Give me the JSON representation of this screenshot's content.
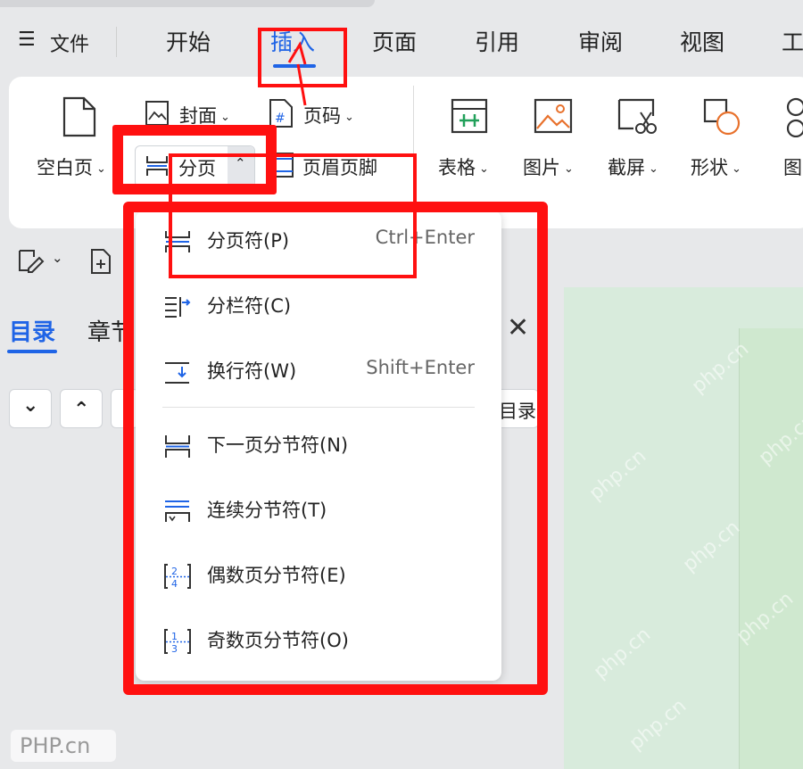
{
  "menubar": {
    "hamburger": "☰",
    "file_label": "文件",
    "items": [
      "开始",
      "插入",
      "页面",
      "引用",
      "审阅",
      "视图",
      "工"
    ],
    "active_index": 1
  },
  "ribbon": {
    "blank_page": "空白页",
    "cover": "封面",
    "page_break": "分页",
    "page_number": "页码",
    "header_footer": "页眉页脚",
    "table": "表格",
    "picture": "图片",
    "screenshot": "截屏",
    "shape": "形状",
    "chart_partial": "图"
  },
  "panel": {
    "tab_toc": "目录",
    "tab_chapter": "章节",
    "toc_button_partial": "目录"
  },
  "dropdown": {
    "items": [
      {
        "label": "分页符(P)",
        "shortcut": "Ctrl+Enter"
      },
      {
        "label": "分栏符(C)",
        "shortcut": ""
      },
      {
        "label": "换行符(W)",
        "shortcut": "Shift+Enter"
      },
      {
        "label": "下一页分节符(N)",
        "shortcut": ""
      },
      {
        "label": "连续分节符(T)",
        "shortcut": ""
      },
      {
        "label": "偶数页分节符(E)",
        "shortcut": ""
      },
      {
        "label": "奇数页分节符(O)",
        "shortcut": ""
      }
    ]
  },
  "watermark": {
    "text": "php.cn",
    "logo": "PHP.cn"
  },
  "colors": {
    "accent": "#1f64e6",
    "annotation_red": "#ff1010",
    "document_green": "#d8ebdc"
  }
}
